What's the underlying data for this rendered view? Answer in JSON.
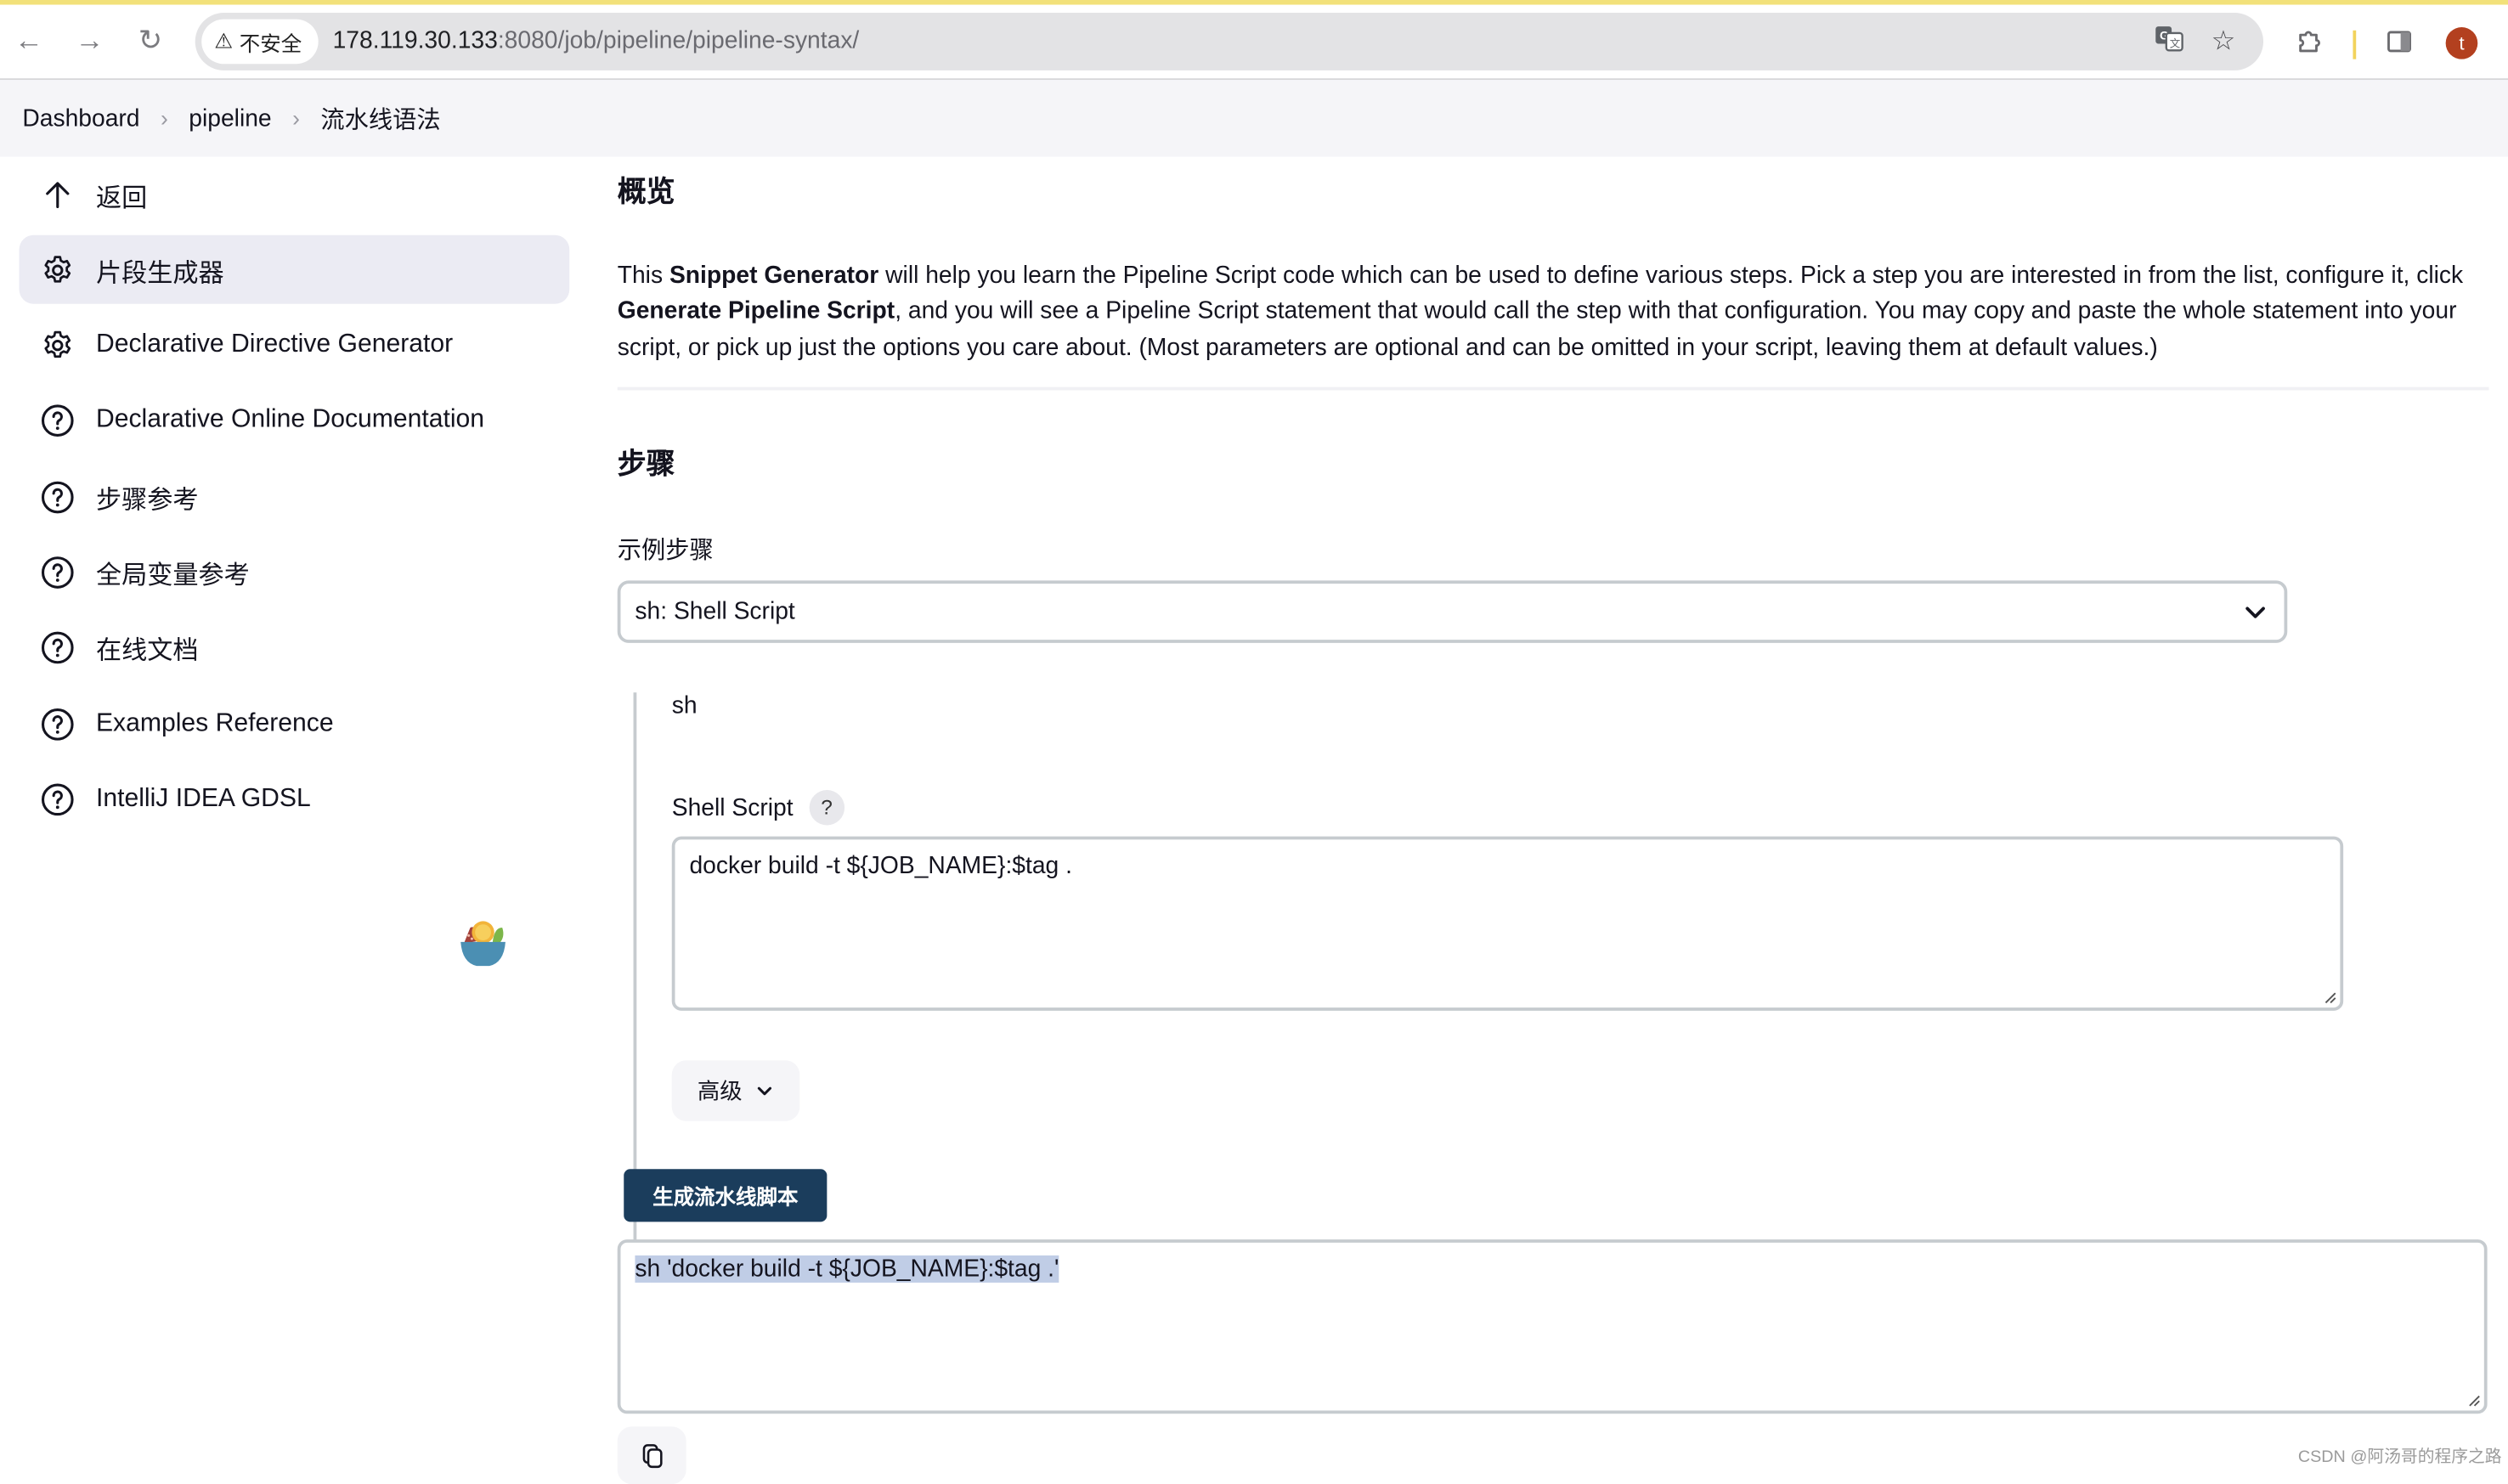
{
  "browser": {
    "security_label": "不安全",
    "url_host": "178.119.30.133",
    "url_rest": ":8080/job/pipeline/pipeline-syntax/",
    "avatar_letter": "t",
    "accent_colors": {
      "avatar": "#b3401f",
      "top_bar": "#f2e17a"
    }
  },
  "breadcrumb": {
    "items": [
      "Dashboard",
      "pipeline",
      "流水线语法"
    ],
    "separator": "›"
  },
  "sidebar": {
    "items": [
      {
        "label": "返回",
        "icon": "arrow-up-icon",
        "active": false
      },
      {
        "label": "片段生成器",
        "icon": "gear-icon",
        "active": true
      },
      {
        "label": "Declarative Directive Generator",
        "icon": "gear-icon",
        "active": false
      },
      {
        "label": "Declarative Online Documentation",
        "icon": "help-circle-icon",
        "active": false
      },
      {
        "label": "步骤参考",
        "icon": "help-circle-icon",
        "active": false
      },
      {
        "label": "全局变量参考",
        "icon": "help-circle-icon",
        "active": false
      },
      {
        "label": "在线文档",
        "icon": "help-circle-icon",
        "active": false
      },
      {
        "label": "Examples Reference",
        "icon": "help-circle-icon",
        "active": false
      },
      {
        "label": "IntelliJ IDEA GDSL",
        "icon": "help-circle-icon",
        "active": false
      }
    ]
  },
  "main": {
    "overview_title": "概览",
    "intro": {
      "p1": "This ",
      "b1": "Snippet Generator",
      "p2": " will help you learn the Pipeline Script code which can be used to define various steps. Pick a step you are interested in from the list, configure it, click ",
      "b2": "Generate Pipeline Script",
      "p3": ", and you will see a Pipeline Script statement that would call the step with that configuration. You may copy and paste the whole statement into your script, or pick up just the options you care about. (Most parameters are optional and can be omitted in your script, leaving them at default values.)"
    },
    "steps_title": "步骤",
    "sample_step_label": "示例步骤",
    "sample_step_value": "sh: Shell Script",
    "step_name": "sh",
    "shell_script_label": "Shell Script",
    "help_glyph": "?",
    "shell_script_value": "docker build -t ${JOB_NAME}:$tag .",
    "advanced_label": "高级",
    "generate_button": "生成流水线脚本",
    "generated_script": "sh 'docker build -t ${JOB_NAME}:$tag .'",
    "primary_color": "#1b3d5c"
  },
  "watermark": "CSDN @阿汤哥的程序之路"
}
